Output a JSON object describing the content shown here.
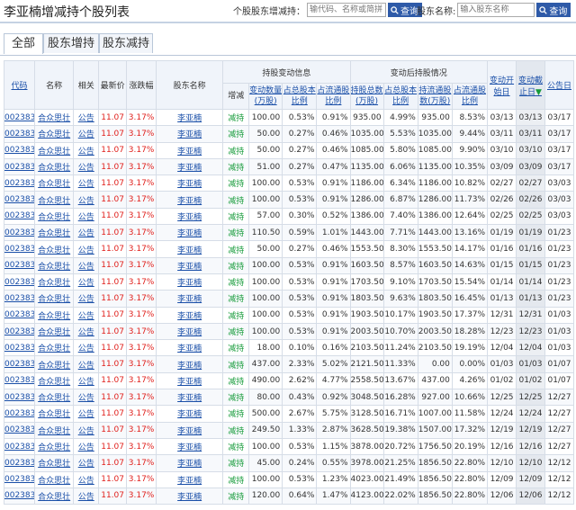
{
  "page_title": "李亚楠增减持个股列表",
  "stock_search": {
    "label": "个股股东增减持：",
    "placeholder": "输代码、名称或简拼",
    "button": "查询"
  },
  "holder_search": {
    "label": "股东名称:",
    "placeholder": "输入股东名称",
    "button": "查询"
  },
  "tabs": [
    {
      "label": "全部",
      "active": true
    },
    {
      "label": "股东增持"
    },
    {
      "label": "股东减持"
    }
  ],
  "headers": {
    "code": "代码",
    "name": "名称",
    "related": "相关",
    "price": "最新价",
    "change": "涨跌幅",
    "holder": "股东名称",
    "change_group": "持股变动信息",
    "after_group": "变动后持股情况",
    "action": "增减",
    "qty": "变动数量(万股)",
    "pct_total": "占总股本比例",
    "pct_float": "占流通股比例",
    "hold_total": "持股总数(万股)",
    "hold_total_pct": "占总股本比例",
    "hold_float": "持流通股数(万股)",
    "hold_float_pct": "占流通股比例",
    "start_date": "变动开始日",
    "end_date": "变动截止日",
    "announce": "公告日"
  },
  "rows": [
    [
      "002383",
      "合众思壮",
      "公告",
      "11.07",
      "3.17%",
      "李亚楠",
      "减持",
      "100.00",
      "0.53%",
      "0.91%",
      "935.00",
      "4.99%",
      "935.00",
      "8.53%",
      "03/13",
      "03/13",
      "03/17"
    ],
    [
      "002383",
      "合众思壮",
      "公告",
      "11.07",
      "3.17%",
      "李亚楠",
      "减持",
      "50.00",
      "0.27%",
      "0.46%",
      "1035.00",
      "5.53%",
      "1035.00",
      "9.44%",
      "03/11",
      "03/11",
      "03/17"
    ],
    [
      "002383",
      "合众思壮",
      "公告",
      "11.07",
      "3.17%",
      "李亚楠",
      "减持",
      "50.00",
      "0.27%",
      "0.46%",
      "1085.00",
      "5.80%",
      "1085.00",
      "9.90%",
      "03/10",
      "03/10",
      "03/17"
    ],
    [
      "002383",
      "合众思壮",
      "公告",
      "11.07",
      "3.17%",
      "李亚楠",
      "减持",
      "51.00",
      "0.27%",
      "0.47%",
      "1135.00",
      "6.06%",
      "1135.00",
      "10.35%",
      "03/09",
      "03/09",
      "03/17"
    ],
    [
      "002383",
      "合众思壮",
      "公告",
      "11.07",
      "3.17%",
      "李亚楠",
      "减持",
      "100.00",
      "0.53%",
      "0.91%",
      "1186.00",
      "6.34%",
      "1186.00",
      "10.82%",
      "02/27",
      "02/27",
      "03/03"
    ],
    [
      "002383",
      "合众思壮",
      "公告",
      "11.07",
      "3.17%",
      "李亚楠",
      "减持",
      "100.00",
      "0.53%",
      "0.91%",
      "1286.00",
      "6.87%",
      "1286.00",
      "11.73%",
      "02/26",
      "02/26",
      "03/03"
    ],
    [
      "002383",
      "合众思壮",
      "公告",
      "11.07",
      "3.17%",
      "李亚楠",
      "减持",
      "57.00",
      "0.30%",
      "0.52%",
      "1386.00",
      "7.40%",
      "1386.00",
      "12.64%",
      "02/25",
      "02/25",
      "03/03"
    ],
    [
      "002383",
      "合众思壮",
      "公告",
      "11.07",
      "3.17%",
      "李亚楠",
      "减持",
      "110.50",
      "0.59%",
      "1.01%",
      "1443.00",
      "7.71%",
      "1443.00",
      "13.16%",
      "01/19",
      "01/19",
      "01/23"
    ],
    [
      "002383",
      "合众思壮",
      "公告",
      "11.07",
      "3.17%",
      "李亚楠",
      "减持",
      "50.00",
      "0.27%",
      "0.46%",
      "1553.50",
      "8.30%",
      "1553.50",
      "14.17%",
      "01/16",
      "01/16",
      "01/23"
    ],
    [
      "002383",
      "合众思壮",
      "公告",
      "11.07",
      "3.17%",
      "李亚楠",
      "减持",
      "100.00",
      "0.53%",
      "0.91%",
      "1603.50",
      "8.57%",
      "1603.50",
      "14.63%",
      "01/15",
      "01/15",
      "01/23"
    ],
    [
      "002383",
      "合众思壮",
      "公告",
      "11.07",
      "3.17%",
      "李亚楠",
      "减持",
      "100.00",
      "0.53%",
      "0.91%",
      "1703.50",
      "9.10%",
      "1703.50",
      "15.54%",
      "01/14",
      "01/14",
      "01/23"
    ],
    [
      "002383",
      "合众思壮",
      "公告",
      "11.07",
      "3.17%",
      "李亚楠",
      "减持",
      "100.00",
      "0.53%",
      "0.91%",
      "1803.50",
      "9.63%",
      "1803.50",
      "16.45%",
      "01/13",
      "01/13",
      "01/23"
    ],
    [
      "002383",
      "合众思壮",
      "公告",
      "11.07",
      "3.17%",
      "李亚楠",
      "减持",
      "100.00",
      "0.53%",
      "0.91%",
      "1903.50",
      "10.17%",
      "1903.50",
      "17.37%",
      "12/31",
      "12/31",
      "01/03"
    ],
    [
      "002383",
      "合众思壮",
      "公告",
      "11.07",
      "3.17%",
      "李亚楠",
      "减持",
      "100.00",
      "0.53%",
      "0.91%",
      "2003.50",
      "10.70%",
      "2003.50",
      "18.28%",
      "12/23",
      "12/23",
      "01/03"
    ],
    [
      "002383",
      "合众思壮",
      "公告",
      "11.07",
      "3.17%",
      "李亚楠",
      "减持",
      "18.00",
      "0.10%",
      "0.16%",
      "2103.50",
      "11.24%",
      "2103.50",
      "19.19%",
      "12/04",
      "12/04",
      "01/03"
    ],
    [
      "002383",
      "合众思壮",
      "公告",
      "11.07",
      "3.17%",
      "李亚楠",
      "减持",
      "437.00",
      "2.33%",
      "5.02%",
      "2121.50",
      "11.33%",
      "0.00",
      "0.00%",
      "01/03",
      "01/03",
      "01/07"
    ],
    [
      "002383",
      "合众思壮",
      "公告",
      "11.07",
      "3.17%",
      "李亚楠",
      "减持",
      "490.00",
      "2.62%",
      "4.77%",
      "2558.50",
      "13.67%",
      "437.00",
      "4.26%",
      "01/02",
      "01/02",
      "01/07"
    ],
    [
      "002383",
      "合众思壮",
      "公告",
      "11.07",
      "3.17%",
      "李亚楠",
      "减持",
      "80.00",
      "0.43%",
      "0.92%",
      "3048.50",
      "16.28%",
      "927.00",
      "10.66%",
      "12/25",
      "12/25",
      "12/27"
    ],
    [
      "002383",
      "合众思壮",
      "公告",
      "11.07",
      "3.17%",
      "李亚楠",
      "减持",
      "500.00",
      "2.67%",
      "5.75%",
      "3128.50",
      "16.71%",
      "1007.00",
      "11.58%",
      "12/24",
      "12/24",
      "12/27"
    ],
    [
      "002383",
      "合众思壮",
      "公告",
      "11.07",
      "3.17%",
      "李亚楠",
      "减持",
      "249.50",
      "1.33%",
      "2.87%",
      "3628.50",
      "19.38%",
      "1507.00",
      "17.32%",
      "12/19",
      "12/19",
      "12/27"
    ],
    [
      "002383",
      "合众思壮",
      "公告",
      "11.07",
      "3.17%",
      "李亚楠",
      "减持",
      "100.00",
      "0.53%",
      "1.15%",
      "3878.00",
      "20.72%",
      "1756.50",
      "20.19%",
      "12/16",
      "12/16",
      "12/27"
    ],
    [
      "002383",
      "合众思壮",
      "公告",
      "11.07",
      "3.17%",
      "李亚楠",
      "减持",
      "45.00",
      "0.24%",
      "0.55%",
      "3978.00",
      "21.25%",
      "1856.50",
      "22.80%",
      "12/10",
      "12/10",
      "12/12"
    ],
    [
      "002383",
      "合众思壮",
      "公告",
      "11.07",
      "3.17%",
      "李亚楠",
      "减持",
      "100.00",
      "0.53%",
      "1.23%",
      "4023.00",
      "21.49%",
      "1856.50",
      "22.80%",
      "12/09",
      "12/09",
      "12/12"
    ],
    [
      "002383",
      "合众思壮",
      "公告",
      "11.07",
      "3.17%",
      "李亚楠",
      "减持",
      "120.00",
      "0.64%",
      "1.47%",
      "4123.00",
      "22.02%",
      "1856.50",
      "22.80%",
      "12/06",
      "12/06",
      "12/12"
    ]
  ]
}
